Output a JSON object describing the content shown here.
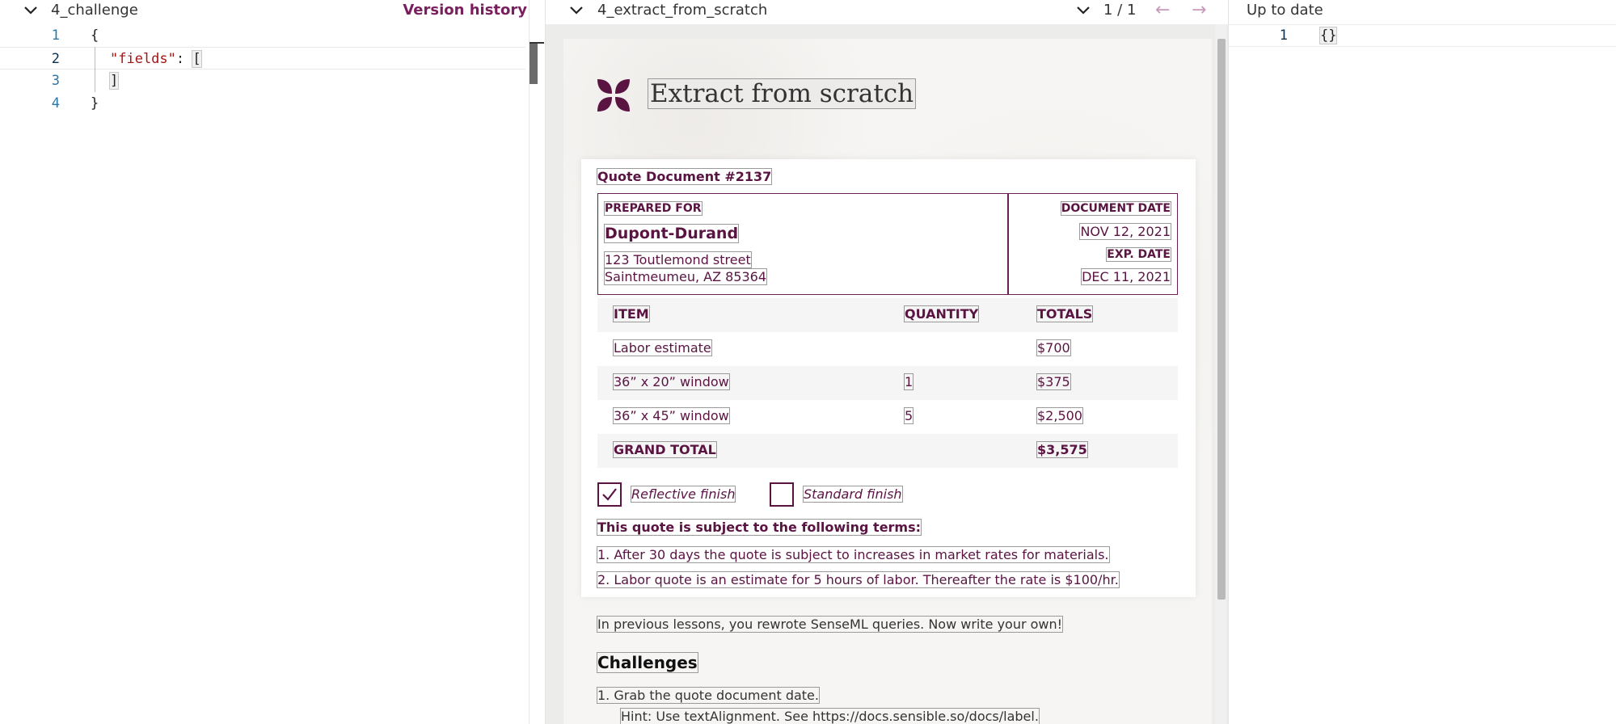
{
  "left_pane": {
    "title": "4_challenge",
    "version_history": "Version history",
    "code_lines": [
      {
        "num": "1",
        "text": "{"
      },
      {
        "num": "2",
        "key": "\"fields\"",
        "sep": ": ",
        "open": "["
      },
      {
        "num": "3",
        "close": "]"
      },
      {
        "num": "4",
        "text": "}"
      }
    ]
  },
  "middle_pane": {
    "title": "4_extract_from_scratch",
    "pager": "1 / 1",
    "prev_arrow": "←",
    "next_arrow": "→",
    "document": {
      "heading": "Extract from scratch",
      "quote_title": "Quote Document #2137",
      "prepared_for_label": "PREPARED FOR",
      "customer_name": "Dupont-Durand",
      "address_line1": "123 Toutlemond street",
      "address_line2": "Saintmeumeu, AZ 85364",
      "document_date_label": "DOCUMENT DATE",
      "document_date": "NOV 12, 2021",
      "exp_date_label": "EXP. DATE",
      "exp_date": "DEC 11, 2021",
      "table": {
        "headers": [
          "ITEM",
          "QUANTITY",
          "TOTALS"
        ],
        "rows": [
          [
            "Labor estimate",
            "",
            "$700"
          ],
          [
            "36” x 20” window",
            "1",
            "$375"
          ],
          [
            "36” x 45” window",
            "5",
            "$2,500"
          ]
        ],
        "grand_total_label": "GRAND TOTAL",
        "grand_total": "$3,575"
      },
      "checkboxes": [
        {
          "label": "Reflective finish",
          "checked": true
        },
        {
          "label": "Standard finish",
          "checked": false
        }
      ],
      "terms_title": "This quote is subject to the following terms:",
      "terms": [
        "1.   After 30 days the quote is subject to increases in market rates for materials.",
        "2.   Labor quote is an estimate for 5 hours of labor. Thereafter the rate is $100/hr."
      ],
      "intro_text": "In previous lessons, you rewrote SenseML queries. Now write your own!",
      "challenges_heading": "Challenges",
      "challenge_1": "1.   Grab the quote document date.",
      "challenge_1_hint": "Hint: Use textAlignment. See https://docs.sensible.so/docs/label."
    }
  },
  "right_pane": {
    "status": "Up to date",
    "line_num": "1",
    "output": "{}"
  },
  "colors": {
    "brand": "#7a1f5e",
    "document_text": "#5a1442",
    "line_number": "#2b78a8"
  }
}
